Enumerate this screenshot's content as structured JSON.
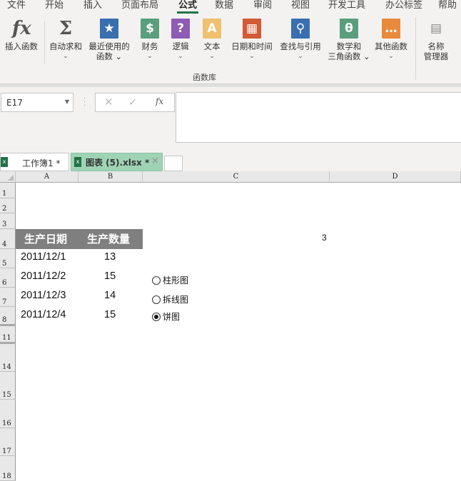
{
  "ribbon": {
    "tabs": [
      "文件",
      "开始",
      "插入",
      "页面布局",
      "公式",
      "数据",
      "审阅",
      "视图",
      "开发工具",
      "办公标签",
      "帮助"
    ],
    "active_tab": "公式",
    "buttons": [
      {
        "label": "插入函数",
        "label2": "",
        "icon": "fx-icon",
        "color": "#555",
        "glyph": "fx"
      },
      {
        "label": "自动求和",
        "label2": "⌄",
        "icon": "sigma-icon",
        "color": "#555",
        "glyph": "Σ"
      },
      {
        "label": "最近使用的",
        "label2": "函数 ⌄",
        "icon": "star-book-icon",
        "color": "#3a6fb0",
        "glyph": "★"
      },
      {
        "label": "财务",
        "label2": "⌄",
        "icon": "coins-book-icon",
        "color": "#5a9e7d",
        "glyph": "$"
      },
      {
        "label": "逻辑",
        "label2": "⌄",
        "icon": "question-book-icon",
        "color": "#8e5bb5",
        "glyph": "?"
      },
      {
        "label": "文本",
        "label2": "⌄",
        "icon": "text-book-icon",
        "color": "#efc070",
        "glyph": "A"
      },
      {
        "label": "日期和时间",
        "label2": "⌄",
        "icon": "calendar-book-icon",
        "color": "#d25a36",
        "glyph": "▦"
      },
      {
        "label": "查找与引用",
        "label2": "⌄",
        "icon": "search-book-icon",
        "color": "#3a6fb0",
        "glyph": "⚲"
      },
      {
        "label": "数学和",
        "label2": "三角函数 ⌄",
        "icon": "theta-book-icon",
        "color": "#5a9e7d",
        "glyph": "θ"
      },
      {
        "label": "其他函数",
        "label2": "⌄",
        "icon": "more-book-icon",
        "color": "#e88a3c",
        "glyph": "…"
      },
      {
        "label": "名称",
        "label2": "管理器",
        "icon": "name-manager-icon",
        "color": "#888",
        "glyph": "▤"
      }
    ],
    "group_label": "函数库"
  },
  "formula_bar": {
    "name_box": "E17",
    "formula": ""
  },
  "doc_tabs": [
    {
      "label": "工作簿1 *"
    },
    {
      "label": "图表 (5).xlsx *",
      "close": "×"
    }
  ],
  "columns": [
    "A",
    "B",
    "C",
    "D"
  ],
  "rows": [
    "1",
    "2",
    "3",
    "4",
    "5",
    "6",
    "7",
    "8",
    "11",
    "14",
    "15",
    "16",
    "17",
    "18"
  ],
  "table": {
    "headers": [
      "生产日期",
      "生产数量"
    ],
    "rows": [
      [
        "2011/12/1",
        "13"
      ],
      [
        "2011/12/2",
        "15"
      ],
      [
        "2011/12/3",
        "14"
      ],
      [
        "2011/12/4",
        "15"
      ]
    ]
  },
  "c4_value": "3",
  "radios": [
    {
      "label": "柱形图",
      "checked": false
    },
    {
      "label": "拆线图",
      "checked": false
    },
    {
      "label": "饼图",
      "checked": true
    }
  ]
}
